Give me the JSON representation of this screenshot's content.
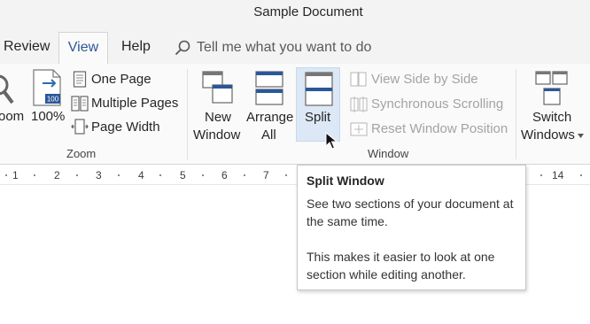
{
  "title": "Sample Document",
  "tabs": [
    {
      "label": "Review"
    },
    {
      "label": "View"
    },
    {
      "label": "Help"
    }
  ],
  "tell_me_placeholder": "Tell me what you want to do",
  "zoom_group": {
    "zoom_label": "oom",
    "hundred_label": "100%",
    "hundred_icon_text": "100",
    "one_page": "One Page",
    "multiple_pages": "Multiple Pages",
    "page_width": "Page Width",
    "group_label": "Zoom"
  },
  "window_group": {
    "new_window_line1": "New",
    "new_window_line2": "Window",
    "arrange_all_line1": "Arrange",
    "arrange_all_line2": "All",
    "split": "Split",
    "view_side_by_side": "View Side by Side",
    "synchronous_scrolling": "Synchronous Scrolling",
    "reset_window_position": "Reset Window Position",
    "switch_windows_line1": "Switch",
    "switch_windows_line2": "Windows",
    "group_label": "Window"
  },
  "ruler_numbers": [
    "1",
    "2",
    "3",
    "4",
    "5",
    "6",
    "7",
    "14"
  ],
  "tooltip": {
    "title": "Split Window",
    "body1": "See two sections of your document at the same time.",
    "body2": "This makes it easier to look at one section while editing another."
  },
  "colors": {
    "accent": "#2b579a",
    "split_highlight": "#dce8f5",
    "disabled_text": "#a3a3a3"
  }
}
